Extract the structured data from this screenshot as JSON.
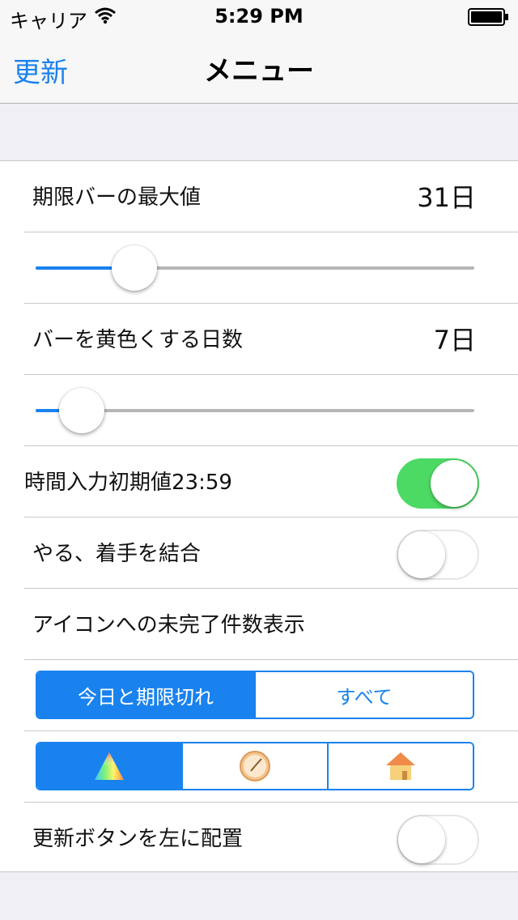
{
  "status_bar": {
    "carrier": "キャリア",
    "time": "5:29 PM",
    "icons": [
      "wifi-icon",
      "battery-icon"
    ]
  },
  "nav": {
    "left_button": "更新",
    "title": "メニュー"
  },
  "settings": {
    "max_bar": {
      "label": "期限バーの最大値",
      "value": "31日",
      "slider_fraction": 0.2
    },
    "yellow_days": {
      "label": "バーを黄色くする日数",
      "value": "7日",
      "slider_fraction": 0.08
    },
    "time_default": {
      "label": "時間入力初期値23:59",
      "on": true
    },
    "combine": {
      "label": "やる、着手を結合",
      "on": false
    },
    "badge_label": "アイコンへの未完了件数表示",
    "badge_options": {
      "options": [
        "今日と期限切れ",
        "すべて"
      ],
      "selected": 0
    },
    "icon_options": {
      "icons": [
        "prism-icon",
        "clock-icon",
        "house-icon"
      ],
      "selected": 0
    },
    "refresh_left": {
      "label": "更新ボタンを左に配置",
      "on": false
    }
  },
  "colors": {
    "accent": "#1a82ee",
    "toggle_on": "#4cd964",
    "background": "#efeff4"
  }
}
